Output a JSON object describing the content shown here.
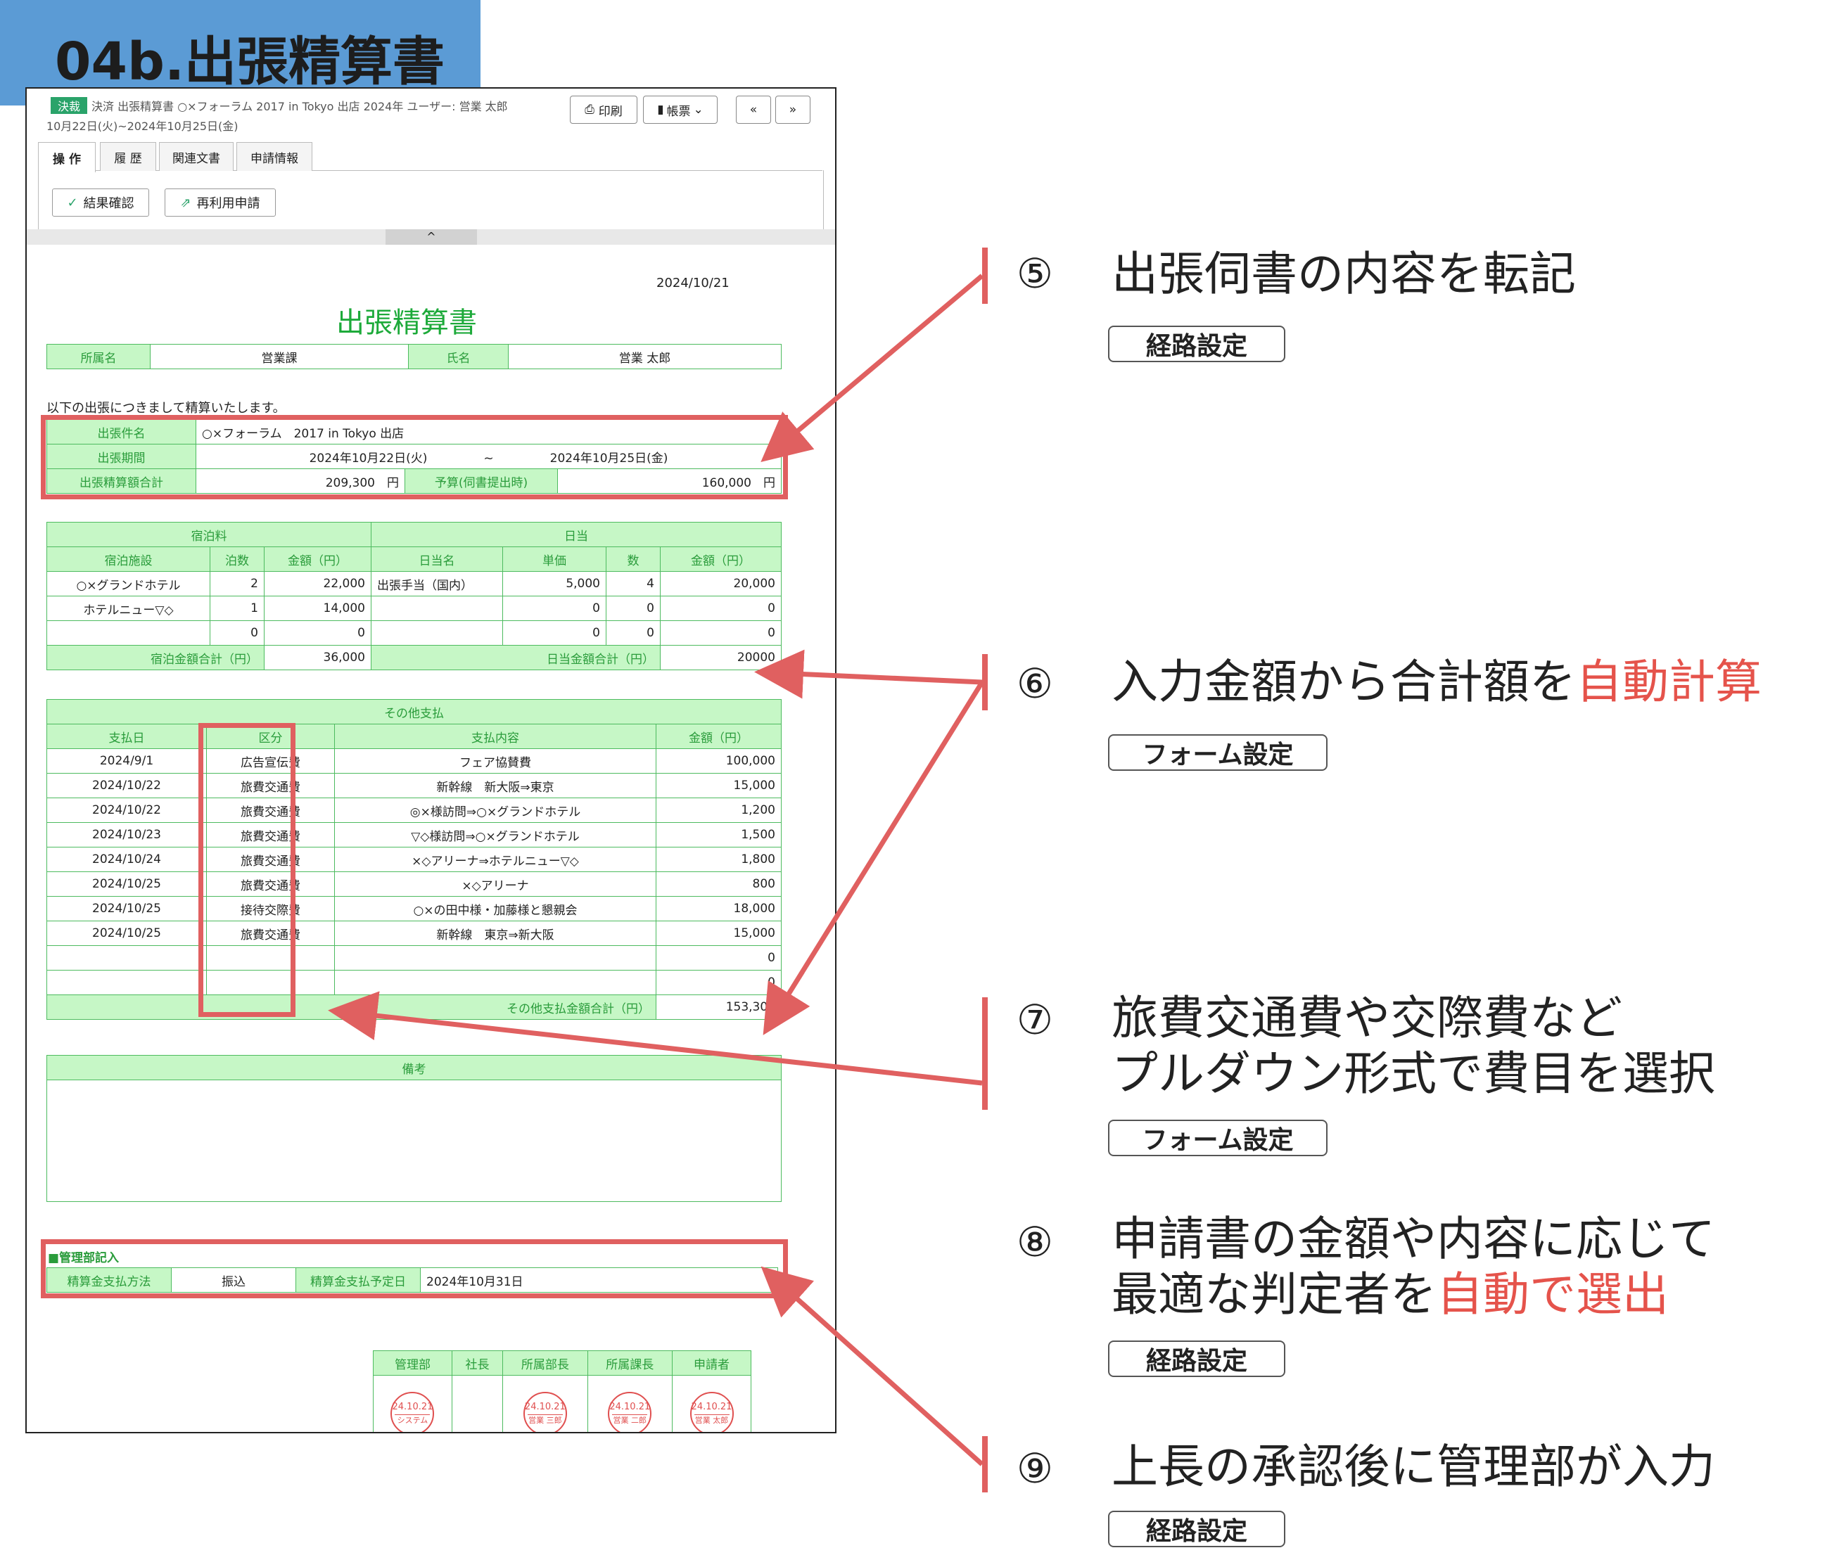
{
  "page_label": "04b.出張精算書",
  "window": {
    "header_line1": "決済  出張精算書 ○×フォーラム 2017 in Tokyo 出店 2024年 ユーザー: 営業 太郎",
    "header_line2": "10月22日(火)~2024年10月25日(金)",
    "status": "決裁",
    "print_label": "印刷",
    "forms_label": "帳票",
    "prev_label": "«",
    "next_label": "»",
    "tabs": [
      "操 作",
      "履 歴",
      "関連文書",
      "申請情報"
    ],
    "actions": {
      "confirm_label": "結果確認",
      "reuse_label": "再利用申請"
    },
    "collapse_icon": "^"
  },
  "form": {
    "date": "2024/10/21",
    "title": "出張精算書",
    "dept_label": "所属名",
    "dept_value": "営業課",
    "name_label": "氏名",
    "name_value": "営業 太郎",
    "intro": "以下の出張につきまして精算いたします。",
    "trip": {
      "subject_label": "出張件名",
      "subject_value": "○×フォーラム　2017 in Tokyo 出店",
      "period_label": "出張期間",
      "period_from": "2024年10月22日(火)",
      "period_sep": "~",
      "period_to": "2024年10月25日(金)",
      "total_label": "出張精算額合計",
      "total_value": "209,300　円",
      "budget_label": "予算(伺書提出時)",
      "budget_value": "160,000　円"
    },
    "lodging": {
      "section": "宿泊料",
      "col_facility": "宿泊施設",
      "col_nights": "泊数",
      "col_amount": "金額（円）",
      "rows": [
        {
          "facility": "○×グランドホテル",
          "nights": "2",
          "amount": "22,000"
        },
        {
          "facility": "ホテルニュー▽◇",
          "nights": "1",
          "amount": "14,000"
        },
        {
          "facility": "",
          "nights": "0",
          "amount": "0"
        }
      ],
      "total_label": "宿泊金額合計（円）",
      "total_value": "36,000"
    },
    "daily": {
      "section": "日当",
      "col_name": "日当名",
      "col_unit": "単価",
      "col_qty": "数",
      "col_amount": "金額（円）",
      "rows": [
        {
          "name": "出張手当（国内）",
          "unit": "5,000",
          "qty": "4",
          "amount": "20,000"
        },
        {
          "name": "",
          "unit": "0",
          "qty": "0",
          "amount": "0"
        },
        {
          "name": "",
          "unit": "0",
          "qty": "0",
          "amount": "0"
        }
      ],
      "total_label": "日当金額合計（円）",
      "total_value": "20000"
    },
    "other": {
      "section": "その他支払",
      "col_date": "支払日",
      "col_type": "区分",
      "col_detail": "支払内容",
      "col_amount": "金額（円）",
      "rows": [
        {
          "date": "2024/9/1",
          "type": "広告宣伝費",
          "detail": "フェア協賛費",
          "amount": "100,000"
        },
        {
          "date": "2024/10/22",
          "type": "旅費交通費",
          "detail": "新幹線　新大阪⇒東京",
          "amount": "15,000"
        },
        {
          "date": "2024/10/22",
          "type": "旅費交通費",
          "detail": "◎×様訪問⇒○×グランドホテル",
          "amount": "1,200"
        },
        {
          "date": "2024/10/23",
          "type": "旅費交通費",
          "detail": "▽◇様訪問⇒○×グランドホテル",
          "amount": "1,500"
        },
        {
          "date": "2024/10/24",
          "type": "旅費交通費",
          "detail": "×◇アリーナ⇒ホテルニュー▽◇",
          "amount": "1,800"
        },
        {
          "date": "2024/10/25",
          "type": "旅費交通費",
          "detail": "×◇アリーナ",
          "amount": "800"
        },
        {
          "date": "2024/10/25",
          "type": "接待交際費",
          "detail": "○×の田中様・加藤様と懇親会",
          "amount": "18,000"
        },
        {
          "date": "2024/10/25",
          "type": "旅費交通費",
          "detail": "新幹線　東京⇒新大阪",
          "amount": "15,000"
        },
        {
          "date": "",
          "type": "",
          "detail": "",
          "amount": "0"
        },
        {
          "date": "",
          "type": "",
          "detail": "",
          "amount": "0"
        }
      ],
      "total_label": "その他支払金額合計（円）",
      "total_value": "153,300"
    },
    "remarks_label": "備考",
    "admin": {
      "heading": "■管理部記入",
      "method_label": "精算金支払方法",
      "method_value": "振込",
      "date_label": "精算金支払予定日",
      "date_value": "2024年10月31日"
    },
    "approvals": [
      {
        "role": "管理部",
        "stamp_date": "24.10.21",
        "stamp_name": "システム"
      },
      {
        "role": "社長",
        "stamp_date": "",
        "stamp_name": ""
      },
      {
        "role": "所属部長",
        "stamp_date": "24.10.21",
        "stamp_name": "営業 三郎"
      },
      {
        "role": "所属課長",
        "stamp_date": "24.10.21",
        "stamp_name": "営業 二郎"
      },
      {
        "role": "申請者",
        "stamp_date": "24.10.21",
        "stamp_name": "営業 太郎"
      }
    ]
  },
  "annotations": [
    {
      "num": "⑤",
      "line1": "出張伺書の内容を転記",
      "line1_red": "",
      "line2": "",
      "line2_red": "",
      "badge": "経路設定"
    },
    {
      "num": "⑥",
      "line1": "入力金額から合計額を",
      "line1_red": "自動計算",
      "line2": "",
      "line2_red": "",
      "badge": "フォーム設定"
    },
    {
      "num": "⑦",
      "line1": "旅費交通費や交際費など",
      "line1_red": "",
      "line2": "プルダウン形式で費目を選択",
      "line2_red": "",
      "badge": "フォーム設定"
    },
    {
      "num": "⑧",
      "line1": "申請書の金額や内容に応じて",
      "line1_red": "",
      "line2": "最適な判定者を",
      "line2_red": "自動で選出",
      "badge": "経路設定"
    },
    {
      "num": "⑨",
      "line1": "上長の承認後に管理部が入力",
      "line1_red": "",
      "line2": "",
      "line2_red": "",
      "badge": "経路設定"
    }
  ],
  "colors": {
    "accent_green": "#1daa3a",
    "header_green": "#c6f7c6",
    "highlight_red": "#e06060",
    "tag_blue": "#5b9bd5"
  }
}
